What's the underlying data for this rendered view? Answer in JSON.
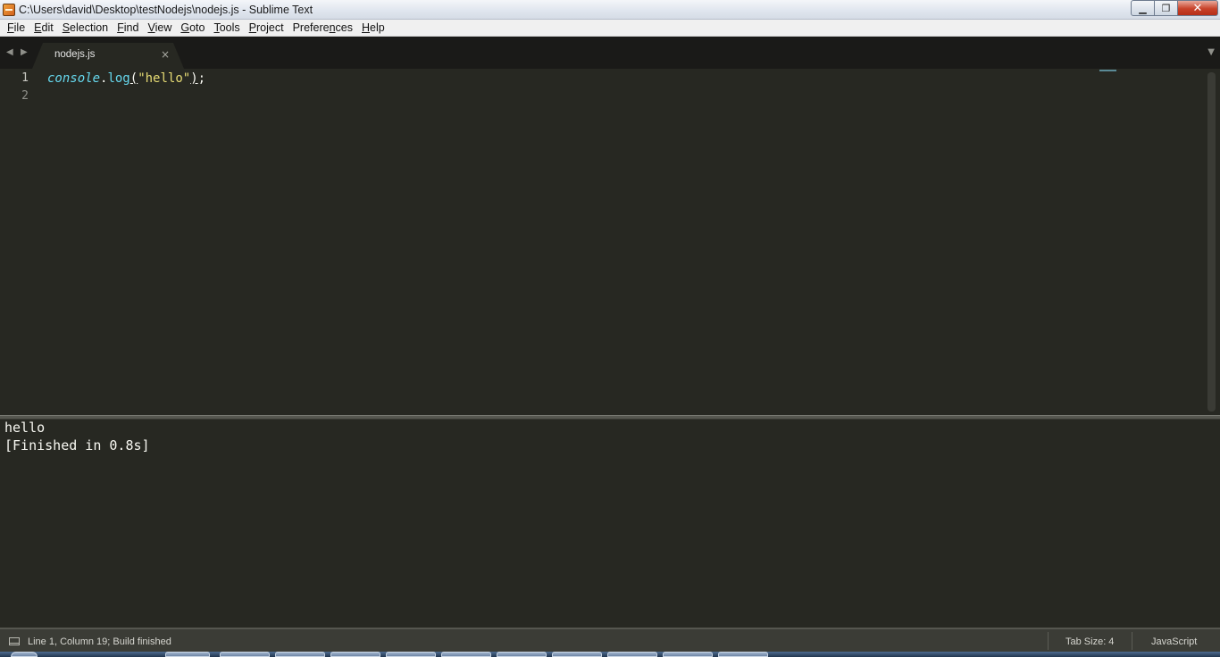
{
  "window": {
    "title": "C:\\Users\\david\\Desktop\\testNodejs\\nodejs.js - Sublime Text",
    "controls": {
      "minimize": "▁",
      "maximize": "❐",
      "close": "✕"
    }
  },
  "menu": [
    {
      "label": "File",
      "accel": "F",
      "rest": "ile"
    },
    {
      "label": "Edit",
      "accel": "E",
      "rest": "dit"
    },
    {
      "label": "Selection",
      "accel": "S",
      "rest": "election"
    },
    {
      "label": "Find",
      "accel": "F",
      "rest": "ind"
    },
    {
      "label": "View",
      "accel": "V",
      "rest": "iew"
    },
    {
      "label": "Goto",
      "accel": "G",
      "rest": "oto"
    },
    {
      "label": "Tools",
      "accel": "T",
      "rest": "ools"
    },
    {
      "label": "Project",
      "accel": "P",
      "rest": "roject"
    },
    {
      "label": "Preferences",
      "accel": "n",
      "pre": "Prefere",
      "rest": "ces"
    },
    {
      "label": "Help",
      "accel": "H",
      "rest": "elp"
    }
  ],
  "tabs": {
    "nav_left": "◀",
    "nav_right": "▶",
    "active": {
      "label": "nodejs.js",
      "close": "×"
    },
    "dropdown": "▼"
  },
  "editor": {
    "line_numbers": [
      "1",
      "2"
    ],
    "code": {
      "object": "console",
      "dot": ".",
      "method": "log",
      "open_paren": "(",
      "string": "\"hello\"",
      "close_paren": ")",
      "semicolon": ";"
    }
  },
  "output": {
    "lines": [
      "hello",
      "[Finished in 0.8s]"
    ]
  },
  "status": {
    "left": "Line 1, Column 19; Build finished",
    "tab_size": "Tab Size: 4",
    "syntax": "JavaScript"
  },
  "colors": {
    "editor_bg": "#272822",
    "keyword_blue": "#66d9ef",
    "string_yellow": "#e6db74",
    "text": "#f8f8f2",
    "gutter": "#8f908a"
  }
}
